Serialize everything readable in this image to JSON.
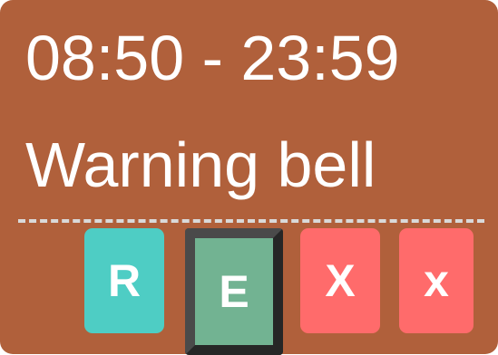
{
  "event": {
    "time_range": "08:50 - 23:59",
    "title": "Warning bell"
  },
  "actions": {
    "r_label": "R",
    "e_label": "E",
    "x_upper_label": "X",
    "x_lower_label": "x"
  },
  "colors": {
    "card_background": "#b0603b",
    "r_button": "#4ecdc4",
    "e_button": "#72b392",
    "x_buttons": "#ff6b6b",
    "divider": "#d9d9d9"
  }
}
